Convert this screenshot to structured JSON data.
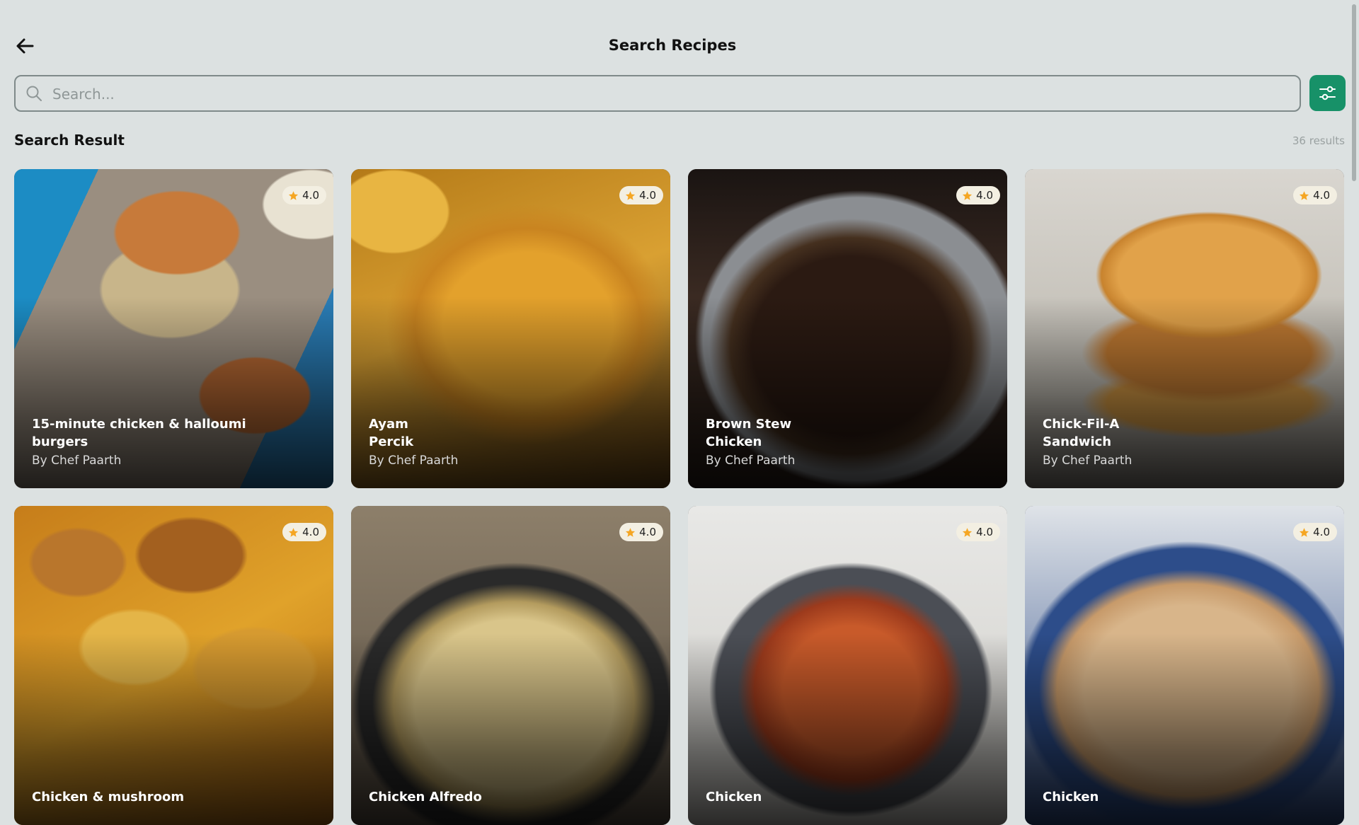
{
  "header": {
    "title": "Search Recipes"
  },
  "search": {
    "placeholder": "Search...",
    "value": ""
  },
  "results": {
    "title": "Search Result",
    "count": "36 results"
  },
  "colors": {
    "accent": "#179168",
    "background": "#dce1e1",
    "star": "#f5a623"
  },
  "cards": [
    {
      "title": "15-minute chicken & halloumi\nburgers",
      "author": "By Chef Paarth",
      "rating": "4.0"
    },
    {
      "title": "Ayam\nPercik",
      "author": "By Chef Paarth",
      "rating": "4.0"
    },
    {
      "title": "Brown Stew\nChicken",
      "author": "By Chef Paarth",
      "rating": "4.0"
    },
    {
      "title": "Chick-Fil-A\nSandwich",
      "author": "By Chef Paarth",
      "rating": "4.0"
    },
    {
      "title": "Chicken & mushroom",
      "author": "",
      "rating": "4.0"
    },
    {
      "title": "Chicken Alfredo",
      "author": "",
      "rating": "4.0"
    },
    {
      "title": "Chicken",
      "author": "",
      "rating": "4.0"
    },
    {
      "title": "Chicken",
      "author": "",
      "rating": "4.0"
    }
  ]
}
